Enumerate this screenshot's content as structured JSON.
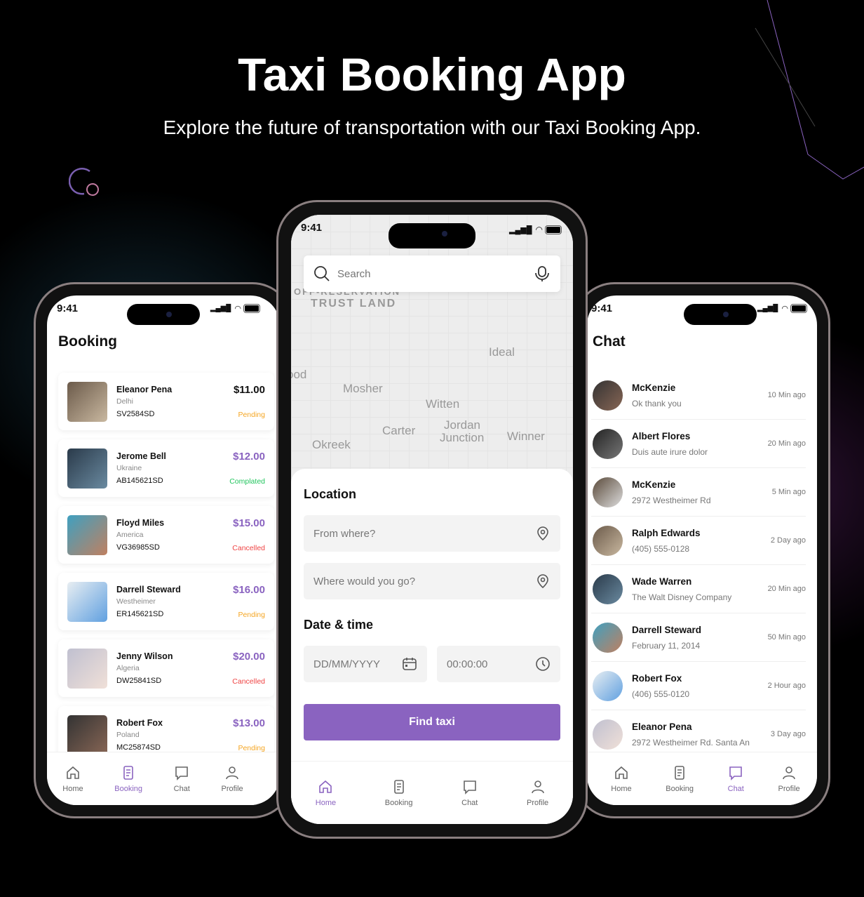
{
  "hero": {
    "title": "Taxi Booking App",
    "subtitle": "Explore the future of transportation with our Taxi Booking App."
  },
  "colors": {
    "accent": "#8a63c0",
    "pending": "#f5a623",
    "completed": "#22c55e",
    "cancelled": "#ef4444"
  },
  "status_bar": {
    "time": "9:41"
  },
  "nav": [
    {
      "label": "Home",
      "icon": "home-icon"
    },
    {
      "label": "Booking",
      "icon": "booking-icon"
    },
    {
      "label": "Chat",
      "icon": "chat-icon"
    },
    {
      "label": "Profile",
      "icon": "profile-icon"
    }
  ],
  "booking": {
    "title": "Booking",
    "active_tab": "Booking",
    "items": [
      {
        "name": "Eleanor Pena",
        "city": "Delhi",
        "id": "SV2584SD",
        "price": "$11.00",
        "status": "Pending"
      },
      {
        "name": "Jerome Bell",
        "city": "Ukraine",
        "id": "AB145621SD",
        "price": "$12.00",
        "status": "Complated"
      },
      {
        "name": "Floyd Miles",
        "city": "America",
        "id": "VG36985SD",
        "price": "$15.00",
        "status": "Cancelled"
      },
      {
        "name": "Darrell Steward",
        "city": "Westheimer",
        "id": "ER145621SD",
        "price": "$16.00",
        "status": "Pending"
      },
      {
        "name": "Jenny Wilson",
        "city": "Algeria",
        "id": "DW25841SD",
        "price": "$20.00",
        "status": "Cancelled"
      },
      {
        "name": "Robert Fox",
        "city": "Poland",
        "id": "MC25874SD",
        "price": "$13.00",
        "status": "Pending"
      }
    ]
  },
  "home": {
    "active_tab": "Home",
    "search_placeholder": "Search",
    "map_labels": [
      "OFF-RESERVATION",
      "TRUST LAND",
      "Ideal",
      "ood",
      "Mosher",
      "Witten",
      "Carter",
      "Jordan",
      "Junction",
      "Winner",
      "Okreek"
    ],
    "location_title": "Location",
    "from_placeholder": "From where?",
    "to_placeholder": "Where would you go?",
    "datetime_title": "Date & time",
    "date_placeholder": "DD/MM/YYYY",
    "time_placeholder": "00:00:00",
    "find_button": "Find taxi"
  },
  "chat": {
    "title": "Chat",
    "active_tab": "Chat",
    "items": [
      {
        "name": "McKenzie",
        "message": "Ok thank you",
        "time": "10 Min ago"
      },
      {
        "name": "Albert Flores",
        "message": "Duis aute irure dolor",
        "time": "20 Min ago"
      },
      {
        "name": "McKenzie",
        "message": "2972 Westheimer Rd",
        "time": "5 Min ago"
      },
      {
        "name": "Ralph Edwards",
        "message": "(405) 555-0128",
        "time": "2 Day ago"
      },
      {
        "name": "Wade Warren",
        "message": "The Walt Disney Company",
        "time": "20 Min ago"
      },
      {
        "name": "Darrell Steward",
        "message": "February 11, 2014",
        "time": "50 Min ago"
      },
      {
        "name": "Robert Fox",
        "message": "(406) 555-0120",
        "time": "2 Hour ago"
      },
      {
        "name": "Eleanor Pena",
        "message": "2972 Westheimer Rd. Santa An",
        "time": "3 Day ago"
      }
    ]
  }
}
